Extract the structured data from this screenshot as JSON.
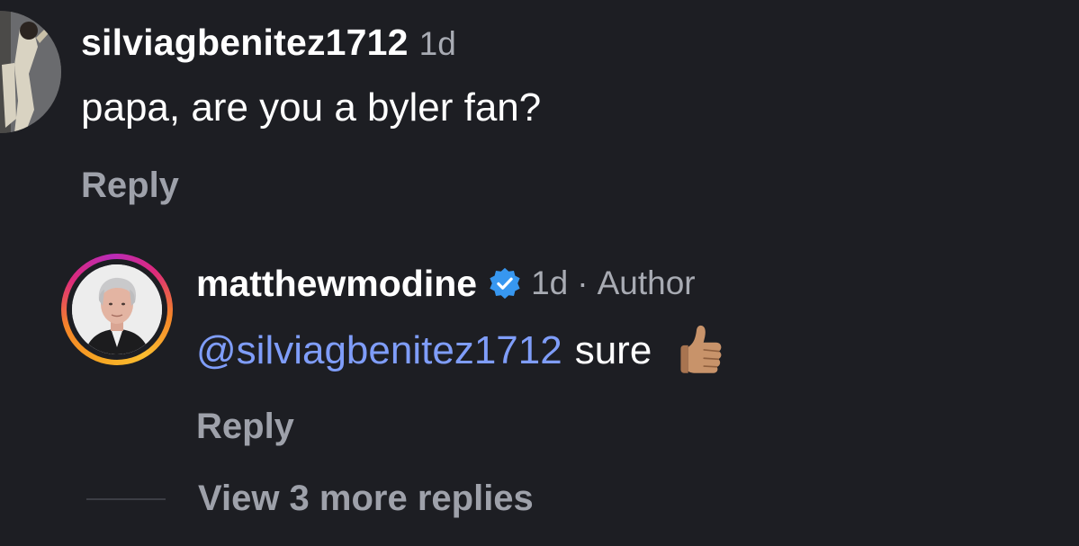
{
  "comment": {
    "username": "silviagbenitez1712",
    "time": "1d",
    "text": "papa, are you a byler fan?",
    "reply_label": "Reply",
    "avatar_icon": "profile-photo"
  },
  "reply": {
    "username": "matthewmodine",
    "verified_icon": "verified-badge-icon",
    "time": "1d",
    "separator": "·",
    "author_label": "Author",
    "mention": "@silviagbenitez1712",
    "text": "sure",
    "emoji": "👍🏽",
    "emoji_icon": "thumbs-up-icon",
    "reply_label": "Reply",
    "avatar_icon": "profile-photo"
  },
  "view_more_label": "View 3 more replies",
  "colors": {
    "background": "#1d1e23",
    "primary_text": "#ffffff",
    "secondary_text": "#a8abb3",
    "mention": "#7f9df9",
    "verified": "#3797f0"
  }
}
